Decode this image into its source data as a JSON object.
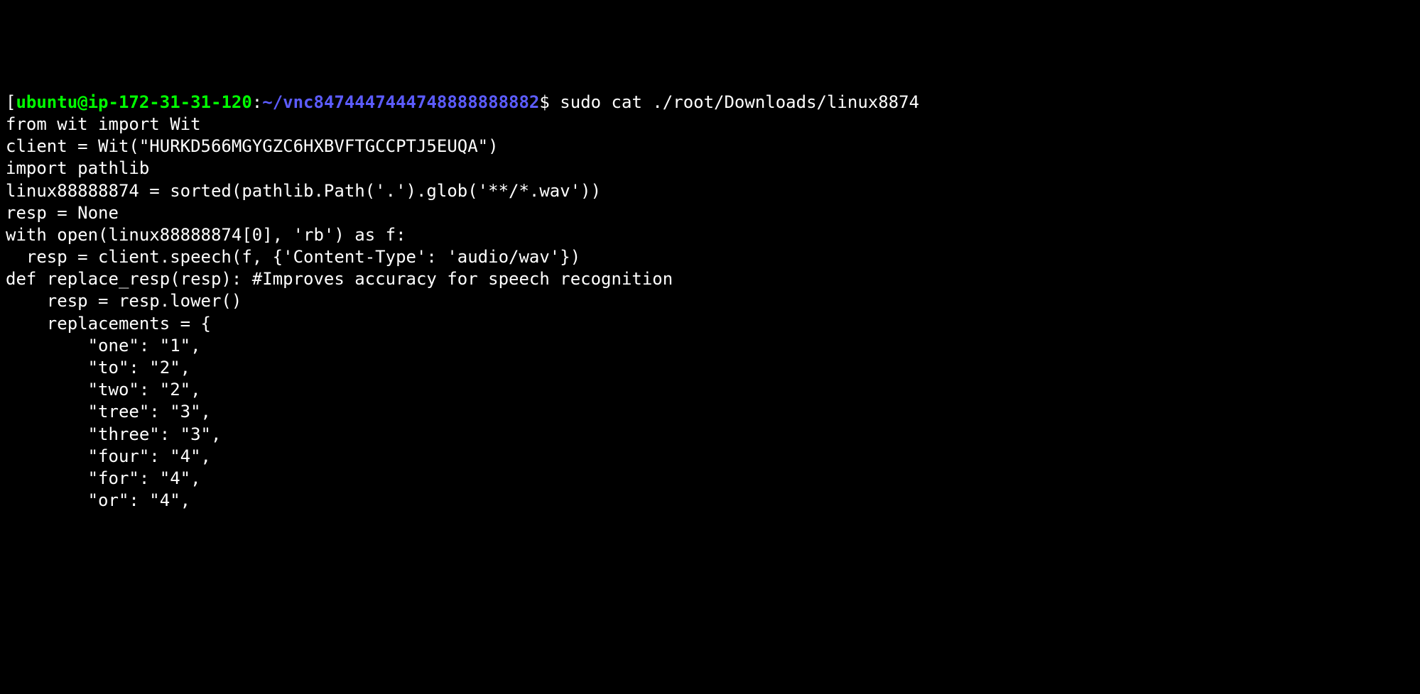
{
  "prompt": {
    "bracket_open": "[",
    "user_host": "ubuntu@ip-172-31-31-120",
    "colon": ":",
    "path": "~/vnc8474447444748888888882",
    "dollar": "$ "
  },
  "command": "sudo cat ./root/Downloads/linux8874",
  "output_lines": [
    "from wit import Wit",
    "",
    "client = Wit(\"HURKD566MGYGZC6HXBVFTGCCPTJ5EUQA\")",
    "",
    "import pathlib",
    "",
    "linux88888874 = sorted(pathlib.Path('.').glob('**/*.wav'))",
    "",
    "resp = None",
    "with open(linux88888874[0], 'rb') as f:",
    "  resp = client.speech(f, {'Content-Type': 'audio/wav'})",
    "",
    "def replace_resp(resp): #Improves accuracy for speech recognition",
    "    resp = resp.lower()",
    "    replacements = {",
    "        \"one\": \"1\",",
    "        \"to\": \"2\",",
    "        \"two\": \"2\",",
    "        \"tree\": \"3\",",
    "        \"three\": \"3\",",
    "        \"four\": \"4\",",
    "        \"for\": \"4\",",
    "        \"or\": \"4\","
  ]
}
